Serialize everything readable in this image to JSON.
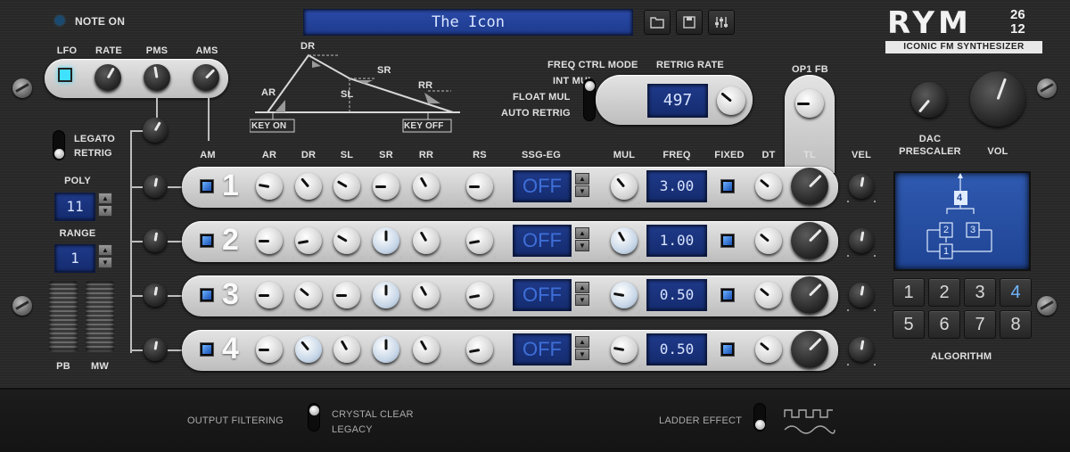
{
  "preset": {
    "name": "The Icon"
  },
  "toolbar": {
    "open_icon": "folder-icon",
    "save_icon": "save-icon",
    "mixer_icon": "sliders-icon"
  },
  "logo": {
    "brand": "RYM",
    "model_top": "26",
    "model_bottom": "12",
    "tagline": "ICONIC FM SYNTHESIZER"
  },
  "note_on": {
    "label": "NOTE ON"
  },
  "lfo": {
    "labels": [
      "LFO",
      "RATE",
      "PMS",
      "AMS"
    ]
  },
  "envelope_diagram": {
    "labels": {
      "dr": "DR",
      "sr": "SR",
      "ar": "AR",
      "sl": "SL",
      "rr": "RR",
      "key_on": "KEY ON",
      "key_off": "KEY OFF"
    }
  },
  "freq_ctrl": {
    "title": "FREQ CTRL MODE",
    "options": [
      "INT MUL",
      "FLOAT MUL",
      "AUTO RETRIG"
    ],
    "retrig_label": "RETRIG RATE",
    "retrig_value": "497"
  },
  "op1fb": {
    "label": "OP1 FB"
  },
  "legato": {
    "labels": [
      "LEGATO",
      "RETRIG"
    ]
  },
  "poly": {
    "label": "POLY",
    "value": "11"
  },
  "range": {
    "label": "RANGE",
    "value": "1"
  },
  "wheels": {
    "pb": "PB",
    "mw": "MW"
  },
  "ops": {
    "headers": [
      "AM",
      "AR",
      "DR",
      "SL",
      "SR",
      "RR",
      "RS",
      "SSG-EG",
      "MUL",
      "FREQ",
      "FIXED",
      "DT",
      "TL",
      "VEL"
    ],
    "rows": [
      {
        "num": "1",
        "ssg": "OFF",
        "freq": "3.00"
      },
      {
        "num": "2",
        "ssg": "OFF",
        "freq": "1.00"
      },
      {
        "num": "3",
        "ssg": "OFF",
        "freq": "0.50"
      },
      {
        "num": "4",
        "ssg": "OFF",
        "freq": "0.50"
      }
    ]
  },
  "dac": {
    "label1": "DAC",
    "label2": "PRESCALER",
    "vol": "VOL"
  },
  "algorithm": {
    "label": "ALGORITHM",
    "buttons": [
      "1",
      "2",
      "3",
      "4",
      "5",
      "6",
      "7",
      "8"
    ],
    "selected": "4",
    "diagram": {
      "ops": [
        "4",
        "2",
        "3",
        "1"
      ]
    }
  },
  "footer": {
    "output_filtering": "OUTPUT FILTERING",
    "opt1": "CRYSTAL CLEAR",
    "opt2": "LEGACY",
    "ladder": "LADDER EFFECT"
  },
  "colors": {
    "lcd": "#1f3a8a",
    "accent": "#6fb6ff",
    "led": "#40e0ff"
  }
}
